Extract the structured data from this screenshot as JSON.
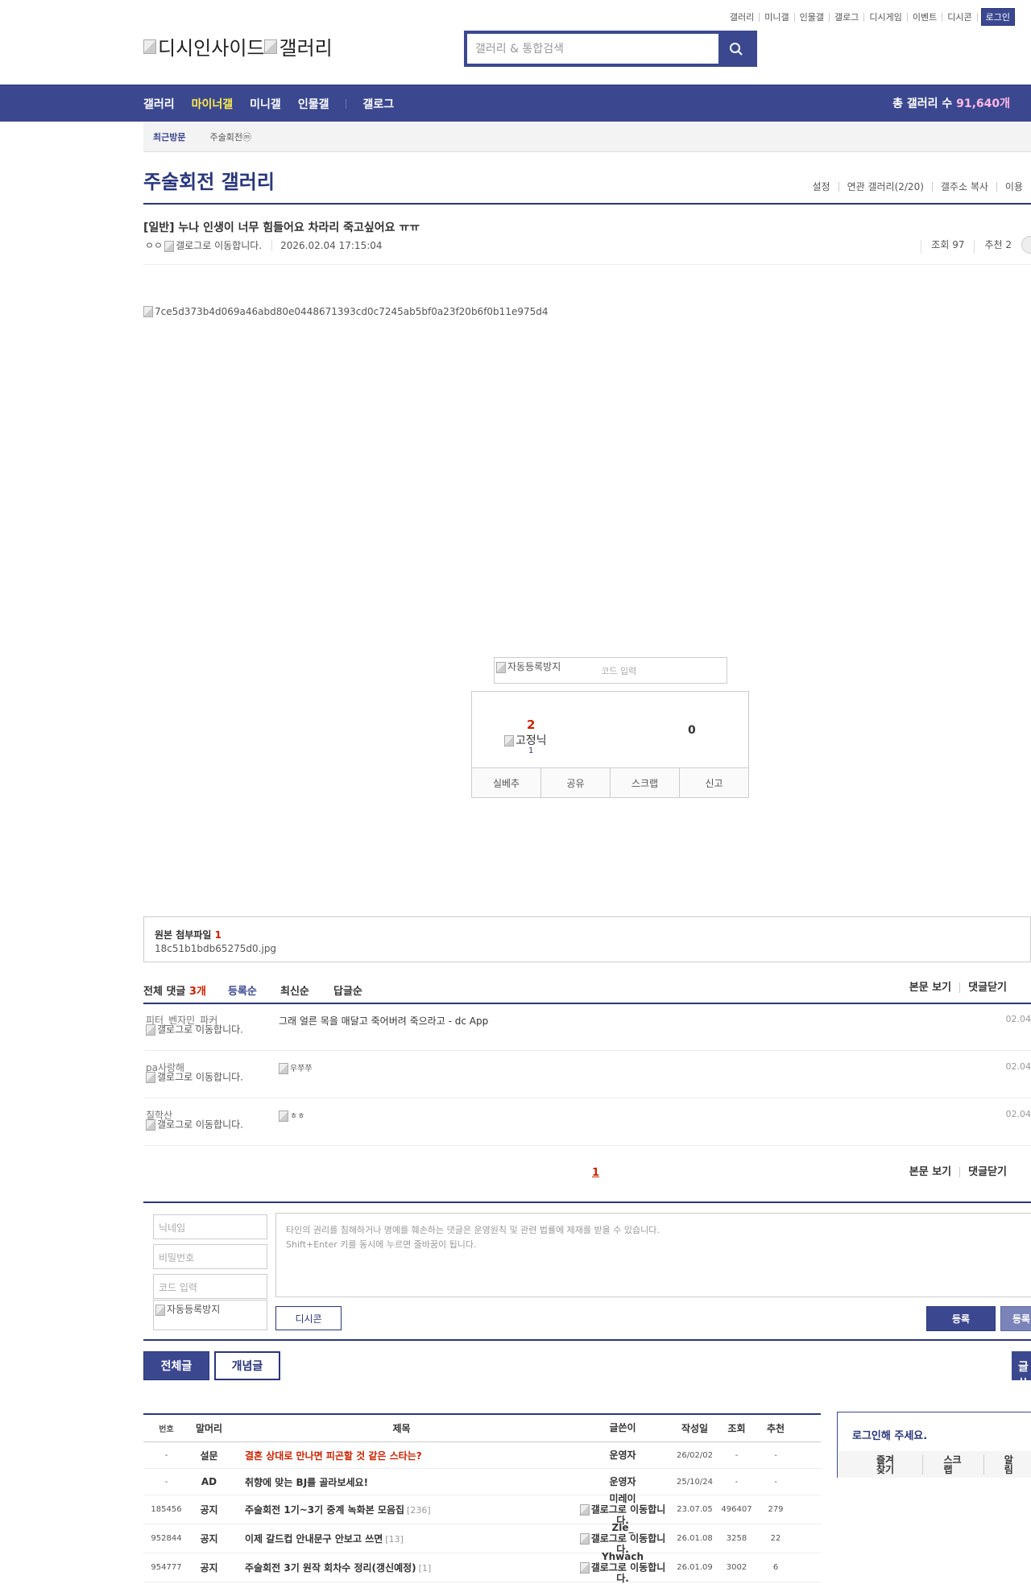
{
  "top_util": {
    "items": [
      "갤러리",
      "미니갤",
      "인물갤",
      "갤로그",
      "디시게임",
      "이벤트",
      "디시콘"
    ],
    "login": "로그인"
  },
  "logo": {
    "site": "디시인사이드",
    "gallery": "갤러리"
  },
  "search": {
    "placeholder": "갤러리 & 통합검색"
  },
  "gnb": {
    "menus": [
      "갤러리",
      "마이너갤",
      "미니갤",
      "인물갤",
      "갤로그"
    ],
    "total_label": "총 갤러리 수",
    "total_value": "91,640개"
  },
  "visit": {
    "label": "최근방문",
    "item": "주술회전ⓜ"
  },
  "gallery": {
    "title": "주술회전 갤러리",
    "util": [
      "설정",
      "연관 갤러리(2/20)",
      "갤주소 복사",
      "이용"
    ]
  },
  "post": {
    "subject": "[일반] 누나 인생이 너무 힘들어요 차라리 죽고싶어요 ㅠㅠ",
    "writer": "ㅇㅇ",
    "writer_icon": "갤로그로 이동합니다.",
    "date": "2026.02.04 17:15:04",
    "views": "조회 97",
    "recommends": "추천 2",
    "image_alt": "7ce5d373b4d069a46abd80e0448671393cd0c7245ab5bf0a23f20b6f0b11e975d4"
  },
  "recommend": {
    "captcha_alt": "자동등록방지",
    "captcha_placeholder": "코드 입력",
    "up_count": "2",
    "fixed_label": "고정닉",
    "fixed_count": "1",
    "down_count": "0",
    "buttons": [
      "실베추",
      "공유",
      "스크랩",
      "신고"
    ]
  },
  "attachment": {
    "title": "원본 첨부파일",
    "count": "1",
    "file": "18c51b1bdb65275d0.jpg"
  },
  "comments": {
    "total_label": "전체 댓글",
    "total_count": "3개",
    "sort": [
      "등록순",
      "최신순",
      "답글순"
    ],
    "right": [
      "본문 보기",
      "댓글닫기"
    ],
    "items": [
      {
        "nick": "피터_벤자민_파커",
        "icon": "갤로그로 이동합니다.",
        "text": "그래 얼른 목을 매달고 죽어버려 죽으라고 - dc App",
        "date": "02.04"
      },
      {
        "nick": "pa사랑해",
        "icon": "갤로그로 이동합니다.",
        "text": "",
        "dccon": "우쭈쭈",
        "date": "02.04"
      },
      {
        "nick": "칠학산",
        "icon": "갤로그로 이동합니다.",
        "text": "",
        "dccon": "ㅎㅎ",
        "date": "02.04"
      }
    ],
    "page": "1",
    "footer": [
      "본문 보기",
      "댓글닫기"
    ]
  },
  "comment_write": {
    "nickname_placeholder": "닉네임",
    "password_placeholder": "비밀번호",
    "code_placeholder": "코드 입력",
    "captcha_alt": "자동등록방지",
    "notice_line1": "타인의 권리를 침해하거나 명예를 훼손하는 댓글은 운영원칙 및 관련 법률에 제재를 받을 수 있습니다.",
    "notice_line2": "Shift+Enter 키를 동시에 누르면 줄바꿈이 됩니다.",
    "dccon": "디시콘",
    "submit": "등록",
    "submit2": "등록"
  },
  "list_buttons": {
    "all": "전체글",
    "concept": "개념글",
    "write": "글쓰기"
  },
  "list": {
    "headers": [
      "번호",
      "말머리",
      "제목",
      "글쓴이",
      "작성일",
      "조회",
      "추천"
    ],
    "rows": [
      {
        "num": "-",
        "head": "설문",
        "title": "결혼 상대로 만나면 피곤할 것 같은 스타는?",
        "reply": "",
        "writer": "운영자",
        "writer_icon": "",
        "date": "26/02/02",
        "views": "-",
        "rec": "-",
        "red": true
      },
      {
        "num": "-",
        "head": "AD",
        "title": "취향에 맞는 BJ를 골라보세요!",
        "reply": "",
        "writer": "운영자",
        "writer_icon": "",
        "date": "25/10/24",
        "views": "-",
        "rec": "-",
        "red": false
      },
      {
        "num": "185456",
        "head": "공지",
        "title": "주술회전 1기~3기 중계 녹화본 모음집",
        "reply": "[236]",
        "writer": "미레이",
        "writer_icon": "갤로그로 이동합니다.",
        "date": "23.07.05",
        "views": "496407",
        "rec": "279",
        "red": false
      },
      {
        "num": "952844",
        "head": "공지",
        "title": "이제 갈드컵 안내문구 안보고 쓰면",
        "reply": "[13]",
        "writer": "Zle_",
        "writer_icon": "갤로그로 이동합니다.",
        "date": "26.01.08",
        "views": "3258",
        "rec": "22",
        "red": false
      },
      {
        "num": "954777",
        "head": "공지",
        "title": "주술회전 3기 원작 회차수 정리(갱신예정)",
        "reply": "[1]",
        "writer": "Yhwach",
        "writer_icon": "갤로그로 이동합니다.",
        "date": "26.01.09",
        "views": "3002",
        "rec": "6",
        "red": false
      }
    ]
  },
  "login_box": {
    "title": "로그인해 주세요.",
    "buttons": [
      "즐겨찾기",
      "스크랩",
      "알림"
    ]
  }
}
